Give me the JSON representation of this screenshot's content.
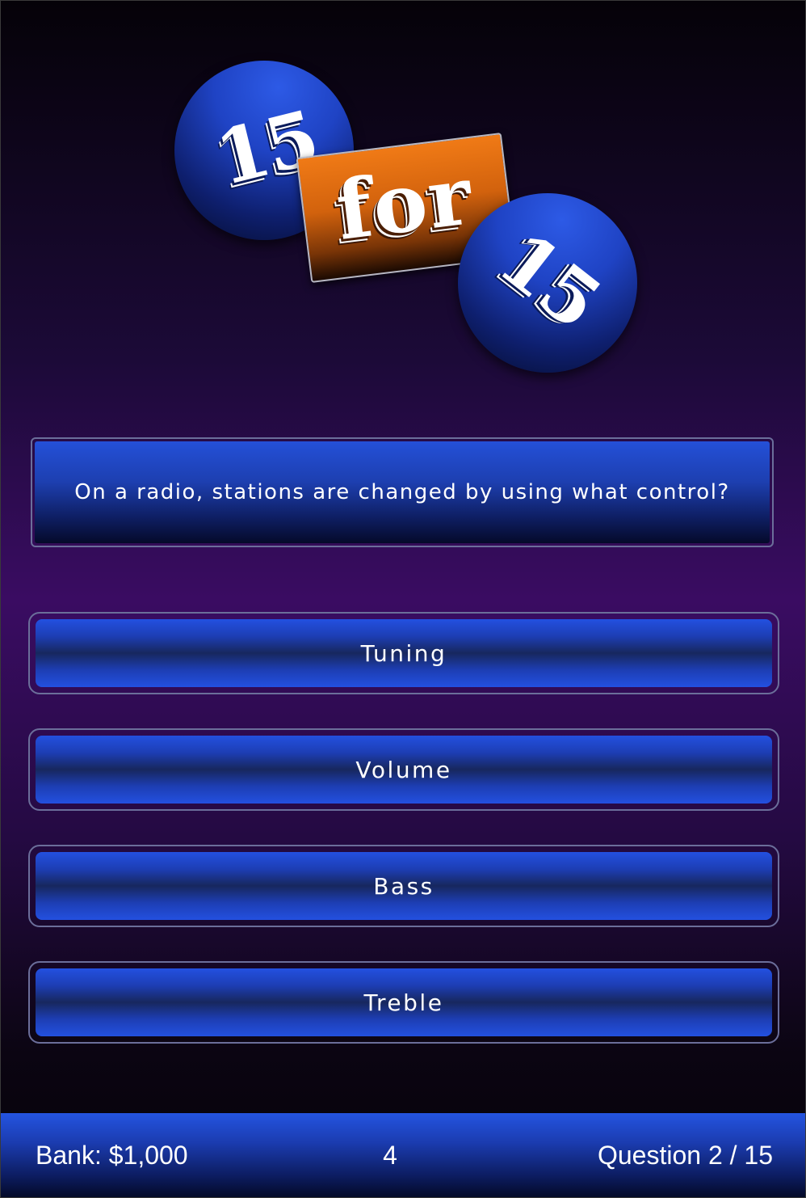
{
  "logo": {
    "top_number": "15",
    "middle_word": "for",
    "bottom_number": "15"
  },
  "question": {
    "text": "On a radio, stations are changed by using what control?"
  },
  "answers": [
    {
      "label": "Tuning"
    },
    {
      "label": "Volume"
    },
    {
      "label": "Bass"
    },
    {
      "label": "Treble"
    }
  ],
  "status": {
    "bank": "Bank: $1,000",
    "timer": "4",
    "question_progress": "Question 2 / 15"
  },
  "colors": {
    "accent_blue": "#1f43c4",
    "logo_orange": "#f07a16",
    "background_purple": "#3a0c62"
  }
}
